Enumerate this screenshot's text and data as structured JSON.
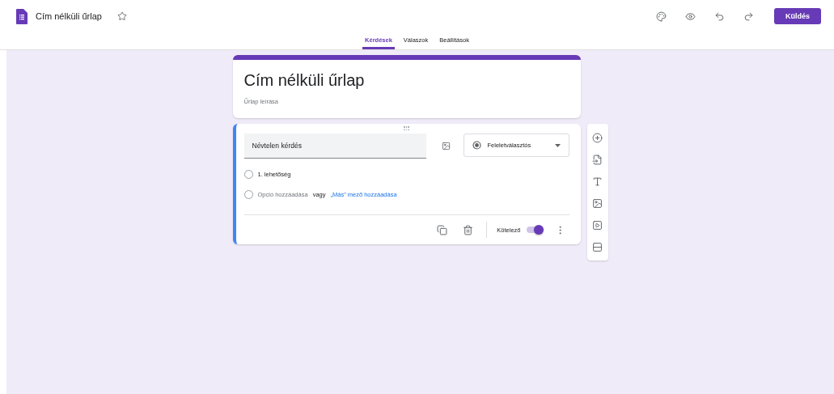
{
  "header": {
    "title": "Cím nélküli űrlap",
    "starred": false,
    "send_button": "Küldés"
  },
  "tabs": [
    {
      "label": "Kérdések",
      "selected": true
    },
    {
      "label": "Válaszok",
      "selected": false
    },
    {
      "label": "Beállítások",
      "selected": false
    }
  ],
  "form": {
    "title": "Cím nélküli űrlap",
    "description": {
      "placeholder": "Űrlap leírása"
    }
  },
  "question": {
    "title": "Névtelen kérdés",
    "type": "Feleletválasztós",
    "options": [
      {
        "label": "1. lehetőség"
      }
    ],
    "add_option": "Opció hozzáadása",
    "or": "vagy",
    "add_other": "„Más” mező hozzáadása",
    "required_label": "Kötelező",
    "required": true
  }
}
